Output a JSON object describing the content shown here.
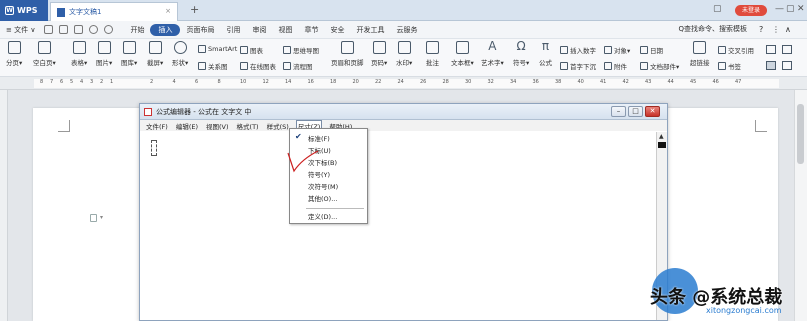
{
  "titlebar": {
    "app_name": "WPS",
    "doc_tab": "文字文稿1",
    "new_tab": "+",
    "login": "未登录",
    "controls": [
      "▢",
      "—",
      "▢",
      "✕"
    ]
  },
  "menubar": {
    "file": "≡ 文件 ∨",
    "items": [
      "开始",
      "插入",
      "页面布局",
      "引用",
      "审阅",
      "视图",
      "章节",
      "安全",
      "开发工具",
      "云服务"
    ],
    "active": "插入",
    "search": "Q查找命令、搜索模板",
    "right_icons": [
      "?",
      "⋮",
      "∧"
    ]
  },
  "ribbon": {
    "large": [
      {
        "label": "分页▾",
        "icon": "page-break-icon"
      },
      {
        "label": "空白页▾",
        "icon": "blank-page-icon"
      },
      {
        "label": "表格▾",
        "icon": "table-icon"
      },
      {
        "label": "图片▾",
        "icon": "picture-icon"
      },
      {
        "label": "图库▾",
        "icon": "gallery-icon"
      },
      {
        "label": "截屏▾",
        "icon": "screenshot-icon"
      },
      {
        "label": "形状▾",
        "icon": "shape-icon"
      },
      {
        "label": "页眉和页脚",
        "icon": "header-footer-icon"
      },
      {
        "label": "页码▾",
        "icon": "page-number-icon"
      },
      {
        "label": "水印▾",
        "icon": "watermark-icon"
      },
      {
        "label": "批注",
        "icon": "comment-icon"
      },
      {
        "label": "文本框▾",
        "icon": "textbox-icon"
      },
      {
        "label": "艺术字▾",
        "icon": "wordart-icon"
      },
      {
        "label": "符号▾",
        "icon": "symbol-icon"
      },
      {
        "label": "公式",
        "icon": "formula-icon"
      },
      {
        "label": "超链接",
        "icon": "hyperlink-icon"
      }
    ],
    "small": [
      {
        "label": "SmartArt",
        "icon": "smartart-icon"
      },
      {
        "label": "图表",
        "icon": "chart-icon"
      },
      {
        "label": "思维导图",
        "icon": "mindmap-icon"
      },
      {
        "label": "关系图",
        "icon": "relation-icon"
      },
      {
        "label": "在线图表",
        "icon": "online-chart-icon"
      },
      {
        "label": "流程图",
        "icon": "flowchart-icon"
      },
      {
        "label": "插入数字",
        "icon": "insert-number-icon"
      },
      {
        "label": "对象▾",
        "icon": "object-icon"
      },
      {
        "label": "日期",
        "icon": "date-icon"
      },
      {
        "label": "首字下沉",
        "icon": "dropcap-icon"
      },
      {
        "label": "附件",
        "icon": "attachment-icon"
      },
      {
        "label": "文档部件▾",
        "icon": "doc-parts-icon"
      },
      {
        "label": "交叉引用",
        "icon": "cross-ref-icon"
      },
      {
        "label": "书签",
        "icon": "bookmark-icon"
      }
    ]
  },
  "ruler": {
    "left_ticks": [
      "8",
      "7",
      "6",
      "5",
      "4",
      "3",
      "2",
      "1"
    ],
    "right_ticks": [
      "2",
      "4",
      "6",
      "8",
      "10",
      "12",
      "14",
      "16",
      "18",
      "20",
      "22",
      "24",
      "26",
      "28",
      "30",
      "32",
      "34",
      "36",
      "38",
      "40",
      "41",
      "42",
      "43",
      "44",
      "45",
      "46",
      "47"
    ]
  },
  "equation_editor": {
    "title": "公式编辑器 - 公式在 文字文 中",
    "menu": [
      "文件(F)",
      "编辑(E)",
      "视图(V)",
      "格式(T)",
      "样式(S)",
      "尺寸(Z)",
      "帮助(H)"
    ],
    "open_menu": "尺寸(Z)",
    "buttons": {
      "minimize": "–",
      "maximize": "□",
      "close": "✕"
    }
  },
  "size_menu": {
    "items": [
      "标准(F)",
      "下标(U)",
      "次下标(B)",
      "符号(Y)",
      "次符号(M)",
      "其他(O)...",
      "定义(D)..."
    ],
    "checked": "标准(F)"
  },
  "watermark": {
    "text": "头条 @系统总裁",
    "brand": "系统总裁",
    "url": "xitongzongcai.com"
  },
  "colors": {
    "accent": "#2f5fa8",
    "login": "#e04b3c",
    "annotation": "#cc1f1f",
    "watermark": "#2a7cd0"
  }
}
